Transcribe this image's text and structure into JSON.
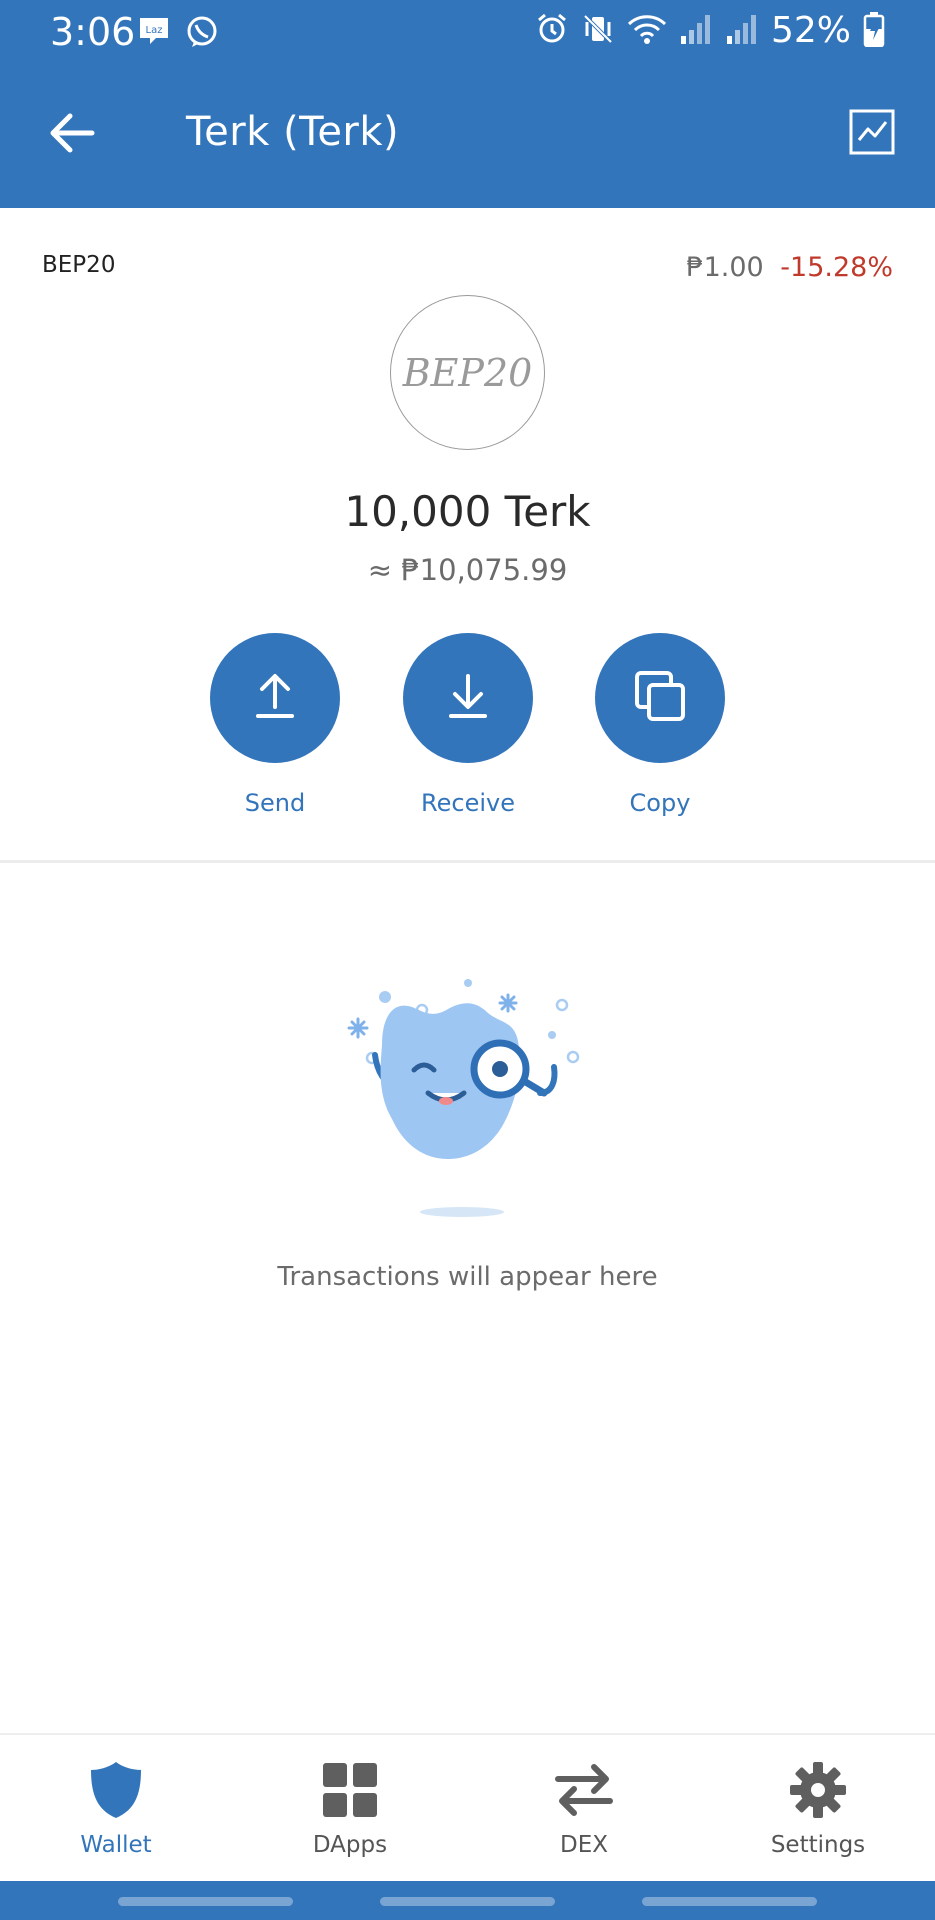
{
  "status_bar": {
    "time": "3:06",
    "battery_percent": "52%",
    "icons": [
      "lazada-notification-icon",
      "viber-notification-icon",
      "alarm-icon",
      "vibrate-icon",
      "wifi-icon",
      "signal-icon",
      "signal-icon",
      "battery-charging-icon"
    ]
  },
  "app_bar": {
    "title": "Terk (Terk)",
    "back_icon": "arrow-left-icon",
    "chart_icon": "chart-icon"
  },
  "token": {
    "standard": "BEP20",
    "logo_text": "BEP20",
    "price": "₱1.00",
    "price_change": "-15.28%",
    "balance": "10,000 Terk",
    "fiat_balance": "≈ ₱10,075.99"
  },
  "actions": {
    "send": "Send",
    "receive": "Receive",
    "copy": "Copy"
  },
  "empty_state": {
    "message": "Transactions will appear here"
  },
  "bottom_nav": {
    "wallet": "Wallet",
    "dapps": "DApps",
    "dex": "DEX",
    "settings": "Settings",
    "active": "wallet"
  },
  "colors": {
    "primary": "#3375bb",
    "negative": "#c0392b",
    "muted_text": "#6b6b6b"
  }
}
